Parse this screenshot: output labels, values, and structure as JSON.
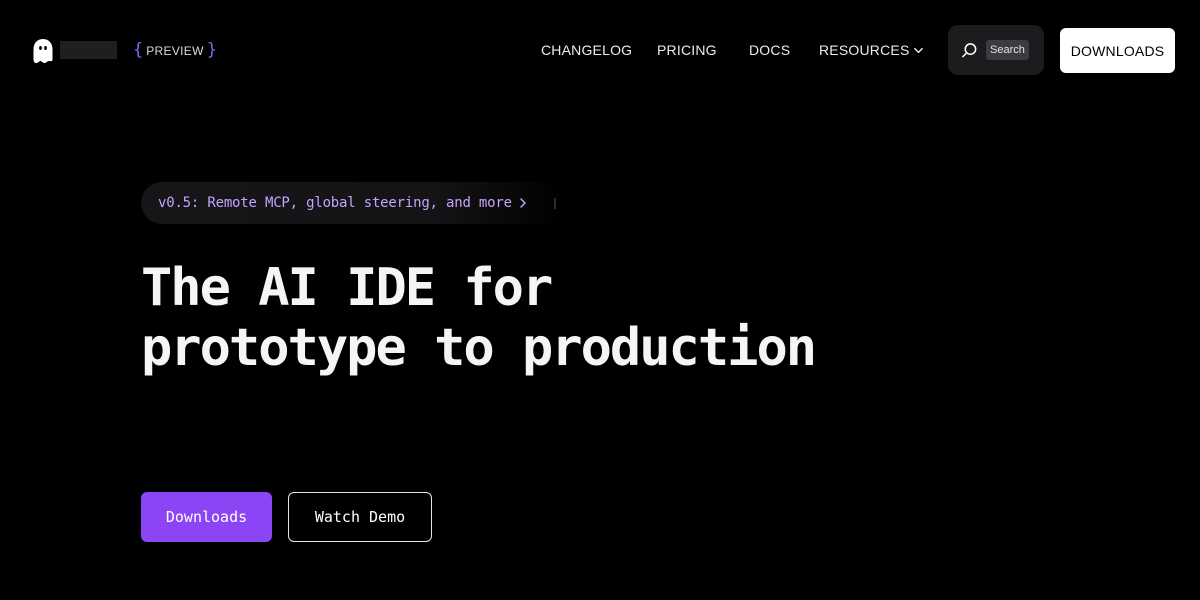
{
  "header": {
    "badge": {
      "open": "{",
      "label": "PREVIEW",
      "close": "}"
    },
    "logo_icon": "ghost-icon",
    "nav": {
      "changelog": "CHANGELOG",
      "pricing": "PRICING",
      "docs": "DOCS",
      "resources": "RESOURCES"
    },
    "search": {
      "label": "Search",
      "icon": "search-icon"
    },
    "downloads_label": "DOWNLOADS"
  },
  "announcement": {
    "text": "v0.5: Remote MCP, global steering, and more",
    "icon": "chevron-right-icon"
  },
  "hero": {
    "line1": "The AI IDE for",
    "line2": "prototype to production"
  },
  "cta": {
    "primary": "Downloads",
    "secondary": "Watch Demo"
  },
  "colors": {
    "background": "#000000",
    "accent": "#8b45f5",
    "announcement_text": "#c4a3ff",
    "brace": "#8b5cf6"
  }
}
